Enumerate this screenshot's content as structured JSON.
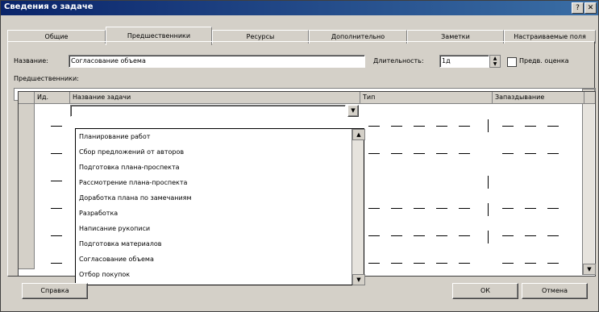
{
  "window": {
    "title": "Сведения о задаче"
  },
  "titlebar_buttons": [
    "?",
    "✕"
  ],
  "tabs": [
    "Общие",
    "Предшественники",
    "Ресурсы",
    "Дополнительно",
    "Заметки",
    "Настраиваемые поля"
  ],
  "active_tab_index": 1,
  "name_label": "Название:",
  "name_value": "Согласование объема",
  "duration_label": "Длительность:",
  "duration_value": "1д",
  "estimate_checkbox_label": "Предв. оценка",
  "predecessors_label": "Предшественники:",
  "toolbar": {
    "cancel_icon": "cancel-x-icon",
    "confirm_icon": "checkmark-icon"
  },
  "grid": {
    "headers": [
      "Ид.",
      "Название задачи",
      "Тип",
      "Запаздывание"
    ],
    "current_value": ""
  },
  "dropdown_items": [
    "Планирование работ",
    "Сбор предложений от авторов",
    "Подготовка плана-проспекта",
    "Рассмотрение плана-проспекта",
    "Доработка плана по замечаниям",
    "Разработка",
    "Написание рукописи",
    "Подготовка материалов",
    "Согласование объема",
    "Отбор покупок"
  ],
  "buttons": {
    "help": "Справка",
    "ok": "ОК",
    "cancel": "Отмена"
  }
}
